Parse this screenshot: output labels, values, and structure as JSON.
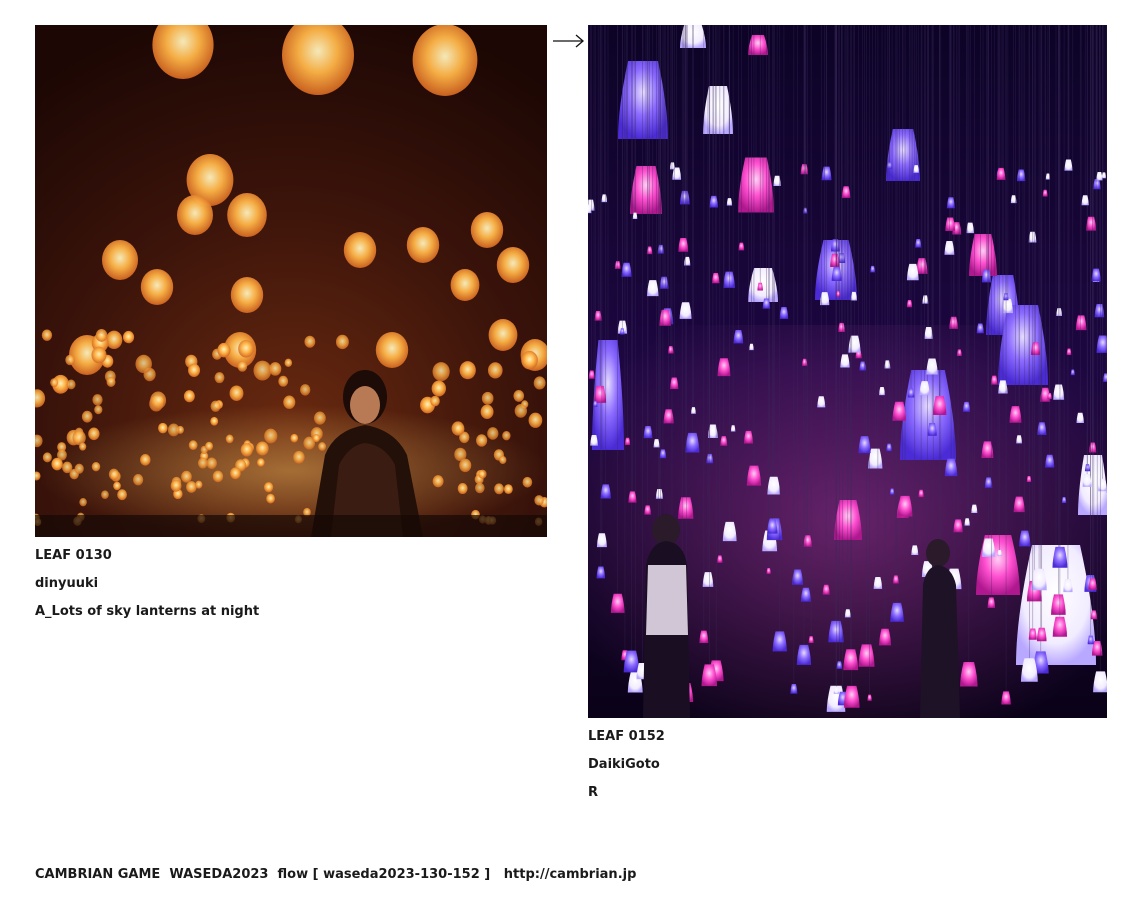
{
  "left_card": {
    "leaf_id": "LEAF 0130",
    "author": "dinyuuki",
    "caption": "A_Lots of sky lanterns at night",
    "image": {
      "subject": "woman standing among floating sky lanterns at night",
      "palette": [
        "#2a0d07",
        "#ff9a2e",
        "#ffd27a"
      ]
    }
  },
  "right_card": {
    "leaf_id": "LEAF 0152",
    "author": "DaikiGoto",
    "caption": "R",
    "image": {
      "subject": "room of glowing hanging lamps in pink and violet",
      "palette": [
        "#12052e",
        "#ff3fc8",
        "#7a5cff"
      ]
    }
  },
  "flow_arrow": {
    "icon": "right-arrow-icon",
    "glyph": "→"
  },
  "footer": {
    "text": "CAMBRIAN GAME  WASEDA2023  flow [ waseda2023-130-152 ]   ",
    "link": "http://cambrian.jp"
  }
}
